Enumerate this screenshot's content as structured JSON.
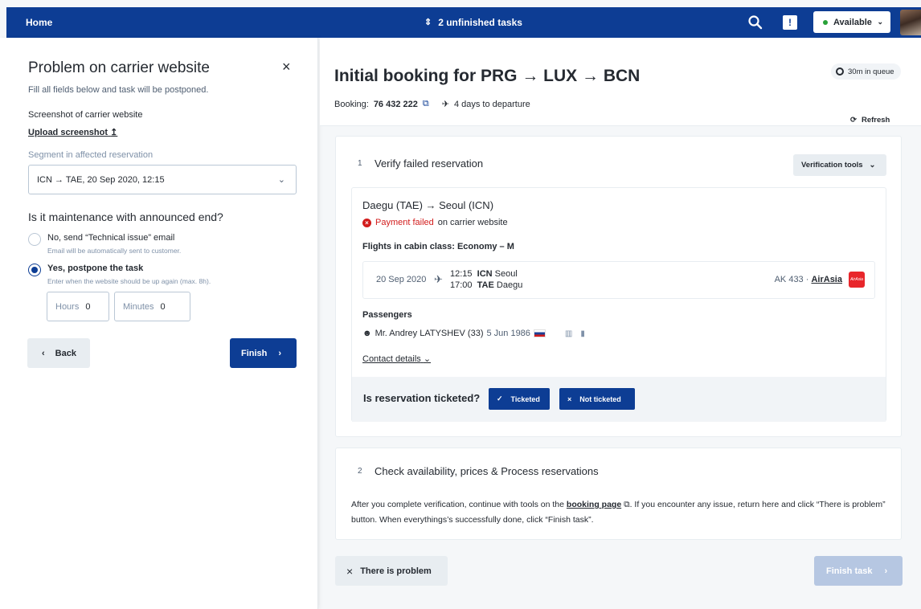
{
  "topbar": {
    "home": "Home",
    "tasks": "2 unfinished tasks",
    "feedback_icon": "!",
    "status": "Available",
    "status_color": "#28a138"
  },
  "left_panel": {
    "title": "Problem on carrier website",
    "close": "×",
    "subtitle": "Fill all fields below and task will be postponed.",
    "screenshot_label": "Screenshot of carrier website",
    "upload_label": "Upload screenshot",
    "upload_icon": "↥",
    "segment_label": "Segment in affected reservation",
    "segment_value": "ICN → TAE, 20 Sep 2020, 12:15",
    "question": "Is it maintenance with announced end?",
    "options": [
      {
        "label": "No, send “Technical issue” email",
        "help": "Email will be automatically sent to customer.",
        "checked": false
      },
      {
        "label": "Yes, postpone the task",
        "help": "Enter when the website should be up again (max. 8h).",
        "checked": true
      }
    ],
    "hours_label": "Hours",
    "hours_value": "0",
    "minutes_label": "Minutes",
    "minutes_value": "0",
    "back_label": "Back",
    "finish_label": "Finish"
  },
  "header": {
    "title": "Initial booking for PRG → LUX → BCN",
    "booking_label": "Booking:",
    "booking_number": "76 432 222",
    "departure": "4 days to departure",
    "queue": "30m in queue",
    "refresh": "Refresh"
  },
  "step1": {
    "number": "1",
    "title": "Verify failed reservation",
    "tools_label": "Verification tools",
    "route": "Daegu (TAE) → Seoul (ICN)",
    "payment_failed": "Payment failed",
    "payment_rest": "on carrier website",
    "cabin": "Flights in cabin class: Economy – M",
    "flight": {
      "date": "20 Sep 2020",
      "dep_time": "12:15",
      "dep_code": "ICN",
      "dep_city": "Seoul",
      "arr_time": "17:00",
      "arr_code": "TAE",
      "arr_city": "Daegu",
      "flight_no": "AK 433 ·",
      "carrier": "AirAsia",
      "carrier_logo": "AirAsia"
    },
    "passengers_label": "Passengers",
    "passenger_name": "Mr. Andrey LATYSHEV (33)",
    "passenger_dob": "5 Jun 1986",
    "contact": "Contact details",
    "ticketed_question": "Is reservation ticketed?",
    "ticketed_btn": "Ticketed",
    "not_ticketed_btn": "Not ticketed"
  },
  "step2": {
    "number": "2",
    "title": "Check availability, prices & Process reservations",
    "text_before": "After you complete verification, continue with tools on the",
    "link": "booking page",
    "text_after": ". If you encounter any issue, return here and click “There is problem” button. When everythings’s successfully done, click “Finish task”."
  },
  "footer": {
    "problem_label": "There is problem",
    "finish_task_label": "Finish task"
  }
}
